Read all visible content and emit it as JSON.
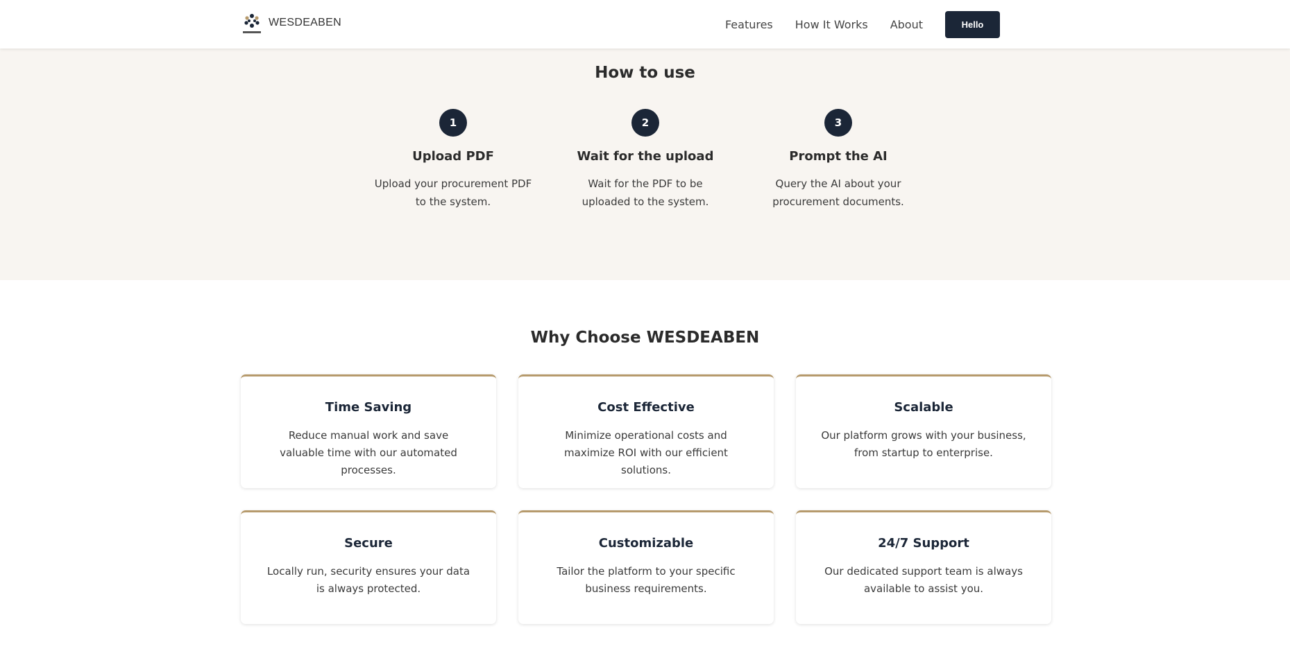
{
  "header": {
    "brand": "WESDEABEN",
    "nav": [
      "Features",
      "How It Works",
      "About"
    ],
    "cta_label": "Hello",
    "accent_color": "#1b2637"
  },
  "how_to_use": {
    "title": "How to use",
    "steps": [
      {
        "number": "1",
        "title": "Upload PDF",
        "description": "Upload your procurement PDF to the system."
      },
      {
        "number": "2",
        "title": "Wait for the upload",
        "description": "Wait for the PDF to be uploaded to the system."
      },
      {
        "number": "3",
        "title": "Prompt the AI",
        "description": "Query the AI about your procurement documents."
      }
    ]
  },
  "why_choose": {
    "title": "Why Choose WESDEABEN",
    "card_accent_color": "#b69a6c",
    "cards": [
      {
        "title": "Time Saving",
        "description": "Reduce manual work and save valuable time with our automated processes."
      },
      {
        "title": "Cost Effective",
        "description": "Minimize operational costs and maximize ROI with our efficient solutions."
      },
      {
        "title": "Scalable",
        "description": "Our platform grows with your business, from startup to enterprise."
      },
      {
        "title": "Secure",
        "description": "Locally run, security ensures your data is always protected."
      },
      {
        "title": "Customizable",
        "description": "Tailor the platform to your specific business requirements."
      },
      {
        "title": "24/7 Support",
        "description": "Our dedicated support team is always available to assist you."
      }
    ]
  }
}
